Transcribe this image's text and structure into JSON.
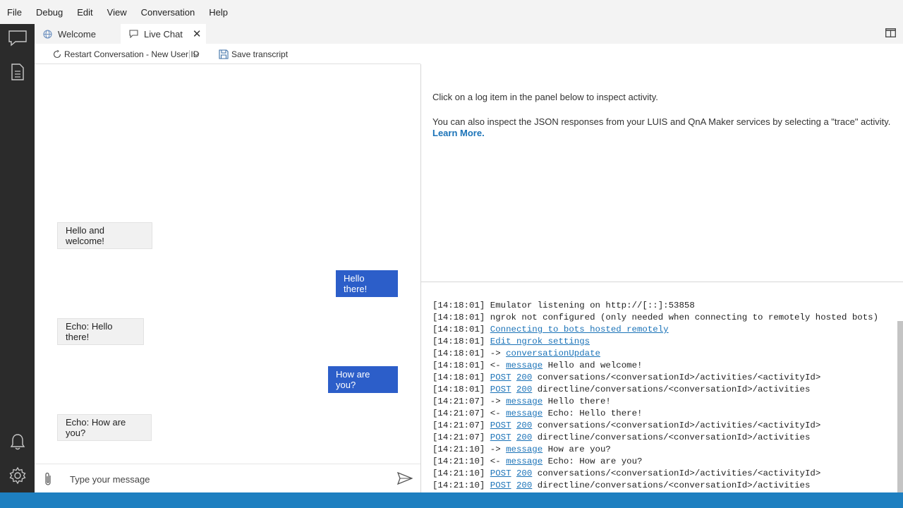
{
  "menu": [
    "File",
    "Debug",
    "Edit",
    "View",
    "Conversation",
    "Help"
  ],
  "tabs": {
    "welcome": "Welcome",
    "live_chat": "Live Chat",
    "close": "✕"
  },
  "toolbar": {
    "restart": "Restart Conversation - New User ID",
    "save": "Save transcript"
  },
  "chat": {
    "messages": [
      {
        "from": "bot",
        "text": "Hello and welcome!"
      },
      {
        "from": "user",
        "text": "Hello there!"
      },
      {
        "from": "bot",
        "text": "Echo: Hello there!"
      },
      {
        "from": "user",
        "text": "How are you?"
      },
      {
        "from": "bot",
        "text": "Echo: How are you?"
      }
    ],
    "input_placeholder": "Type your message"
  },
  "inspector": {
    "line1": "Click on a log item in the panel below to inspect activity.",
    "line2": "You can also inspect the JSON responses from your LUIS and QnA Maker services by selecting a \"trace\" activity.",
    "learn_more": "Learn More."
  },
  "log": [
    {
      "ts": "[14:18:01]",
      "parts": [
        {
          "t": " Emulator listening on http://[::]:53858",
          "link": false
        }
      ]
    },
    {
      "ts": "[14:18:01]",
      "parts": [
        {
          "t": " ngrok not configured (only needed when connecting to remotely hosted bots)",
          "link": false
        }
      ]
    },
    {
      "ts": "[14:18:01]",
      "parts": [
        {
          "t": " ",
          "link": false
        },
        {
          "t": "Connecting to bots hosted remotely",
          "link": true
        }
      ]
    },
    {
      "ts": "[14:18:01]",
      "parts": [
        {
          "t": " ",
          "link": false
        },
        {
          "t": "Edit ngrok settings",
          "link": true
        }
      ]
    },
    {
      "ts": "[14:18:01]",
      "parts": [
        {
          "t": " -> ",
          "link": false
        },
        {
          "t": "conversationUpdate",
          "link": true
        }
      ]
    },
    {
      "ts": "[14:18:01]",
      "parts": [
        {
          "t": " <- ",
          "link": false
        },
        {
          "t": "message",
          "link": true
        },
        {
          "t": " Hello and welcome!",
          "link": false
        }
      ]
    },
    {
      "ts": "[14:18:01]",
      "parts": [
        {
          "t": " ",
          "link": false
        },
        {
          "t": "POST",
          "link": true
        },
        {
          "t": " ",
          "link": false
        },
        {
          "t": "200",
          "link": true
        },
        {
          "t": " conversations/<conversationId>/activities/<activityId>",
          "link": false
        }
      ]
    },
    {
      "ts": "[14:18:01]",
      "parts": [
        {
          "t": " ",
          "link": false
        },
        {
          "t": "POST",
          "link": true
        },
        {
          "t": " ",
          "link": false
        },
        {
          "t": "200",
          "link": true
        },
        {
          "t": " directline/conversations/<conversationId>/activities",
          "link": false
        }
      ]
    },
    {
      "ts": "[14:21:07]",
      "parts": [
        {
          "t": " -> ",
          "link": false
        },
        {
          "t": "message",
          "link": true
        },
        {
          "t": " Hello there!",
          "link": false
        }
      ]
    },
    {
      "ts": "[14:21:07]",
      "parts": [
        {
          "t": " <- ",
          "link": false
        },
        {
          "t": "message",
          "link": true
        },
        {
          "t": " Echo: Hello there!",
          "link": false
        }
      ]
    },
    {
      "ts": "[14:21:07]",
      "parts": [
        {
          "t": " ",
          "link": false
        },
        {
          "t": "POST",
          "link": true
        },
        {
          "t": " ",
          "link": false
        },
        {
          "t": "200",
          "link": true
        },
        {
          "t": " conversations/<conversationId>/activities/<activityId>",
          "link": false
        }
      ]
    },
    {
      "ts": "[14:21:07]",
      "parts": [
        {
          "t": " ",
          "link": false
        },
        {
          "t": "POST",
          "link": true
        },
        {
          "t": " ",
          "link": false
        },
        {
          "t": "200",
          "link": true
        },
        {
          "t": " directline/conversations/<conversationId>/activities",
          "link": false
        }
      ]
    },
    {
      "ts": "[14:21:10]",
      "parts": [
        {
          "t": " -> ",
          "link": false
        },
        {
          "t": "message",
          "link": true
        },
        {
          "t": " How are you?",
          "link": false
        }
      ]
    },
    {
      "ts": "[14:21:10]",
      "parts": [
        {
          "t": " <- ",
          "link": false
        },
        {
          "t": "message",
          "link": true
        },
        {
          "t": " Echo: How are you?",
          "link": false
        }
      ]
    },
    {
      "ts": "[14:21:10]",
      "parts": [
        {
          "t": " ",
          "link": false
        },
        {
          "t": "POST",
          "link": true
        },
        {
          "t": " ",
          "link": false
        },
        {
          "t": "200",
          "link": true
        },
        {
          "t": " conversations/<conversationId>/activities/<activityId>",
          "link": false
        }
      ]
    },
    {
      "ts": "[14:21:10]",
      "parts": [
        {
          "t": " ",
          "link": false
        },
        {
          "t": "POST",
          "link": true
        },
        {
          "t": " ",
          "link": false
        },
        {
          "t": "200",
          "link": true
        },
        {
          "t": " directline/conversations/<conversationId>/activities",
          "link": false
        }
      ]
    }
  ],
  "icons": {
    "activity_bar": [
      "chat-icon",
      "document-icon",
      "bell-icon",
      "gear-icon"
    ],
    "tabs": [
      "globe-icon",
      "chat-bubble-icon"
    ],
    "toolbar": [
      "refresh-icon",
      "chevron-down-icon",
      "save-icon"
    ],
    "input": [
      "paperclip-icon",
      "send-icon"
    ]
  },
  "colors": {
    "accent": "#2c5ec9",
    "link": "#1b73b8",
    "statusbar": "#1e7fc0",
    "activitybar": "#2b2b2b"
  }
}
